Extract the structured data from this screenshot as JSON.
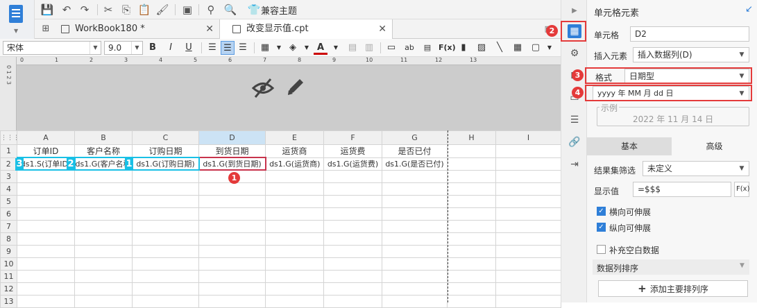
{
  "toolbar": {
    "compat_label": "兼容主题"
  },
  "tabs": [
    {
      "label": "WorkBook180 *"
    },
    {
      "label": "改变显示值.cpt"
    }
  ],
  "format": {
    "font": "宋体",
    "size": "9.0",
    "bold": "B",
    "italic": "I",
    "underline": "U",
    "text_color_label": "A",
    "formula": "F(x)"
  },
  "ruler": [
    "0",
    "1",
    "2",
    "3",
    "4",
    "5",
    "6",
    "7",
    "8",
    "9",
    "10",
    "11",
    "12",
    "13"
  ],
  "grid": {
    "columns": [
      "A",
      "B",
      "C",
      "D",
      "E",
      "F",
      "G",
      "H",
      "I"
    ],
    "rows": [
      [
        "订单ID",
        "客户名称",
        "订购日期",
        "到货日期",
        "运货商",
        "运货费",
        "是否已付",
        "",
        ""
      ],
      [
        "ds1.S(订单ID)",
        "ds1.G(客户名称)",
        "ds1.G(订购日期)",
        "ds1.G(到货日期)",
        "ds1.G(运货商)",
        "ds1.G(运货费)",
        "ds1.G(是否已付)",
        "",
        ""
      ]
    ],
    "row_numbers": [
      "1",
      "2",
      "3",
      "4",
      "5",
      "6",
      "7",
      "8",
      "9",
      "10",
      "11",
      "12",
      "13"
    ]
  },
  "badges": {
    "cell": "1",
    "icon": "2",
    "format": "3",
    "pattern": "4"
  },
  "cyan_markers": [
    "3",
    "2",
    "1"
  ],
  "panel": {
    "title": "单元格元素",
    "cell_label": "单元格",
    "cell_value": "D2",
    "insert_label": "插入元素",
    "insert_value": "插入数据列(D)",
    "format_label": "格式",
    "format_value": "日期型",
    "pattern_value": "yyyy 年 MM 月 dd 日",
    "example_label": "示例",
    "example_value": "2022 年 11 月 14 日",
    "tab_basic": "基本",
    "tab_advanced": "高级",
    "filter_label": "结果集筛选",
    "filter_value": "未定义",
    "display_label": "显示值",
    "display_value": "=$$$",
    "display_fx": "F(x)",
    "expand_h": "横向可伸展",
    "expand_v": "纵向可伸展",
    "fill_blank": "补充空白数据",
    "sort_label": "数据列排序",
    "add_sort": "添加主要排列序"
  },
  "colors": {
    "accent": "#2f7fd8",
    "badge": "#e43a3a",
    "cyan": "#19c0e6",
    "selection": "#c7334c"
  }
}
